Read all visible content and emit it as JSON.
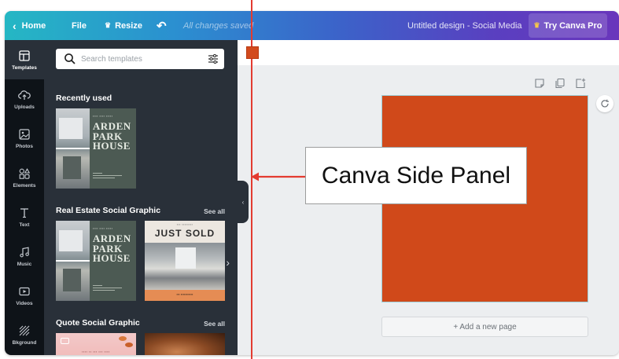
{
  "topbar": {
    "home_label": "Home",
    "file_label": "File",
    "resize_label": "Resize",
    "saved_status": "All changes saved",
    "design_title": "Untitled design - Social Media",
    "try_pro_label": "Try Canva Pro"
  },
  "rail": {
    "items": [
      {
        "label": "Templates",
        "icon": "layout-icon"
      },
      {
        "label": "Uploads",
        "icon": "cloud-upload-icon"
      },
      {
        "label": "Photos",
        "icon": "image-icon"
      },
      {
        "label": "Elements",
        "icon": "shapes-icon"
      },
      {
        "label": "Text",
        "icon": "text-icon"
      },
      {
        "label": "Music",
        "icon": "music-note-icon"
      },
      {
        "label": "Videos",
        "icon": "video-icon"
      },
      {
        "label": "Bkground",
        "icon": "background-pattern-icon"
      }
    ]
  },
  "panel": {
    "search_placeholder": "Search templates",
    "sections": [
      {
        "title": "Recently used",
        "see_all": ""
      },
      {
        "title": "Real Estate Social Graphic",
        "see_all": "See all"
      },
      {
        "title": "Quote Social Graphic",
        "see_all": "See all"
      }
    ],
    "templates": {
      "arden_title": "ARDEN PARK HOUSE",
      "sold_title": "JUST SOLD"
    }
  },
  "editor": {
    "canvas_color": "#D0491A",
    "add_page_label": "+ Add a new page"
  },
  "annotation": {
    "callout_text": "Canva Side Panel",
    "line_color": "#E33B30"
  }
}
